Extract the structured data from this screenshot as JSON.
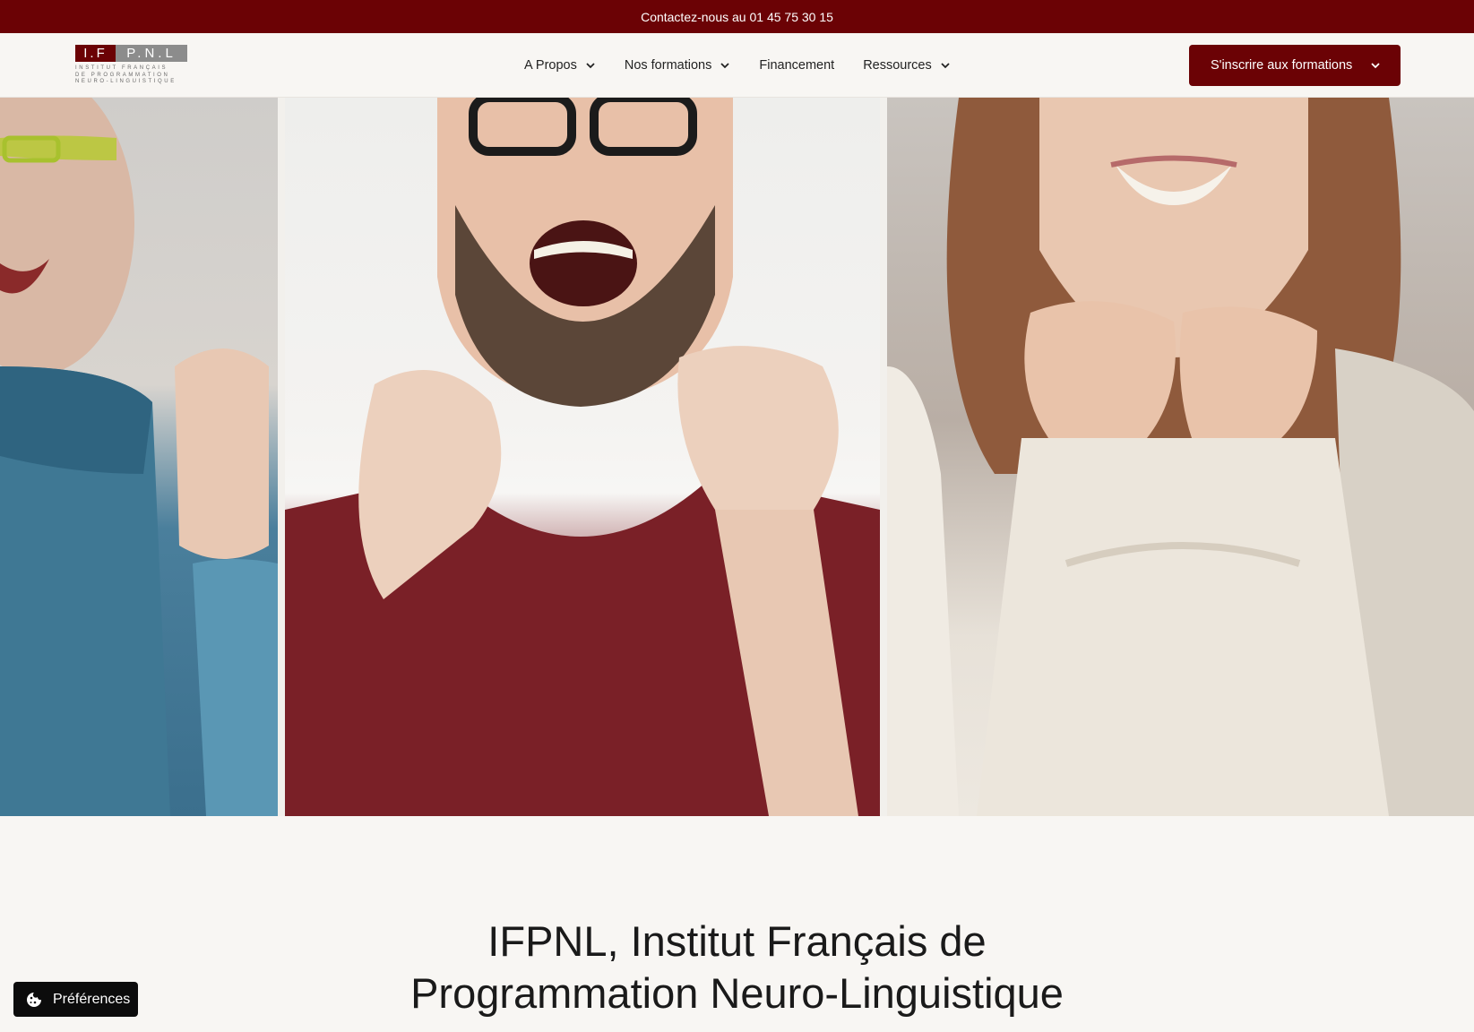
{
  "topbar": {
    "contact_text": "Contactez-nous au 01 45 75 30 15"
  },
  "logo": {
    "left_text": "I.F",
    "right_text": "P.N.L",
    "subtitle_line1": "INSTITUT FRANÇAIS",
    "subtitle_line2": "DE PROGRAMMATION",
    "subtitle_line3": "NEURO-LINGUISTIQUE"
  },
  "nav": {
    "items": [
      {
        "label": "A Propos",
        "has_dropdown": true
      },
      {
        "label": "Nos formations",
        "has_dropdown": true
      },
      {
        "label": "Financement",
        "has_dropdown": false
      },
      {
        "label": "Ressources",
        "has_dropdown": true
      }
    ],
    "cta_label": "S'inscrire aux formations"
  },
  "hero": {
    "panels": [
      "woman-blue-sweater-photo",
      "man-glasses-cheering-photo",
      "woman-smiling-fists-photo"
    ]
  },
  "main": {
    "title_line1": "IFPNL, Institut Français de",
    "title_line2": "Programmation Neuro-Linguistique"
  },
  "cookie_button": {
    "label": "Préférences",
    "icon": "cookie-icon"
  },
  "colors": {
    "brand": "#6b0205",
    "background": "#f8f6f3",
    "logo_grey": "#8c8c8c"
  }
}
